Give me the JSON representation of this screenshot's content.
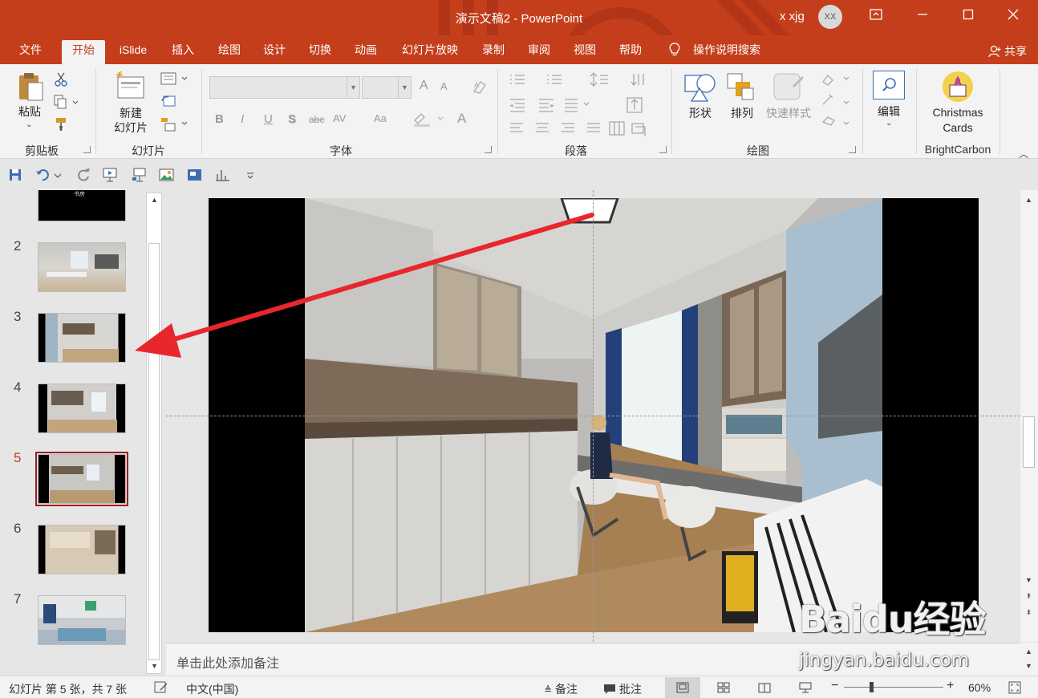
{
  "window": {
    "title": "演示文稿2 - PowerPoint",
    "user": "x xjg",
    "avatar_initials": "XX",
    "buttons": [
      "restore-ribbon",
      "minimize",
      "maximize",
      "close"
    ]
  },
  "menu": {
    "tabs": [
      "文件",
      "开始",
      "iSlide",
      "插入",
      "绘图",
      "设计",
      "切换",
      "动画",
      "幻灯片放映",
      "录制",
      "审阅",
      "视图",
      "帮助"
    ],
    "active_tab": "开始",
    "search": "操作说明搜索",
    "share": "共享"
  },
  "ribbon": {
    "clipboard": {
      "paste": "粘贴",
      "group": "剪贴板"
    },
    "slides": {
      "new_slide_line1": "新建",
      "new_slide_line2": "幻灯片",
      "group": "幻灯片"
    },
    "font": {
      "group": "字体",
      "bold": "B",
      "italic": "I",
      "underline": "U",
      "shadow": "S",
      "strike": "abc",
      "spacing": "AV",
      "case": "Aa",
      "font_color": "A",
      "grow": "A",
      "shrink": "A"
    },
    "paragraph": {
      "group": "段落"
    },
    "drawing": {
      "shapes": "形状",
      "arrange": "排列",
      "quick_styles": "快速样式",
      "group": "绘图"
    },
    "editing": {
      "edit": "编辑"
    },
    "brightcarbon": {
      "item_line1": "Christmas",
      "item_line2": "Cards",
      "group": "BrightCarbon"
    }
  },
  "thumbnails": {
    "numbers": [
      "2",
      "3",
      "4",
      "5",
      "6",
      "7"
    ],
    "selected": "5",
    "partial_thumb_text": "书房"
  },
  "notes": {
    "placeholder": "单击此处添加备注"
  },
  "status": {
    "slide_info": "幻灯片 第 5 张，共 7 张",
    "language": "中文(中国)",
    "notes": "备注",
    "comments": "批注",
    "zoom": "60%"
  },
  "watermark": {
    "logo": "Baidu经验",
    "url": "jingyan.baidu.com"
  },
  "colors": {
    "accent": "#c43e1c",
    "selection": "#9e1e1e",
    "arrow": "#e8262d"
  }
}
